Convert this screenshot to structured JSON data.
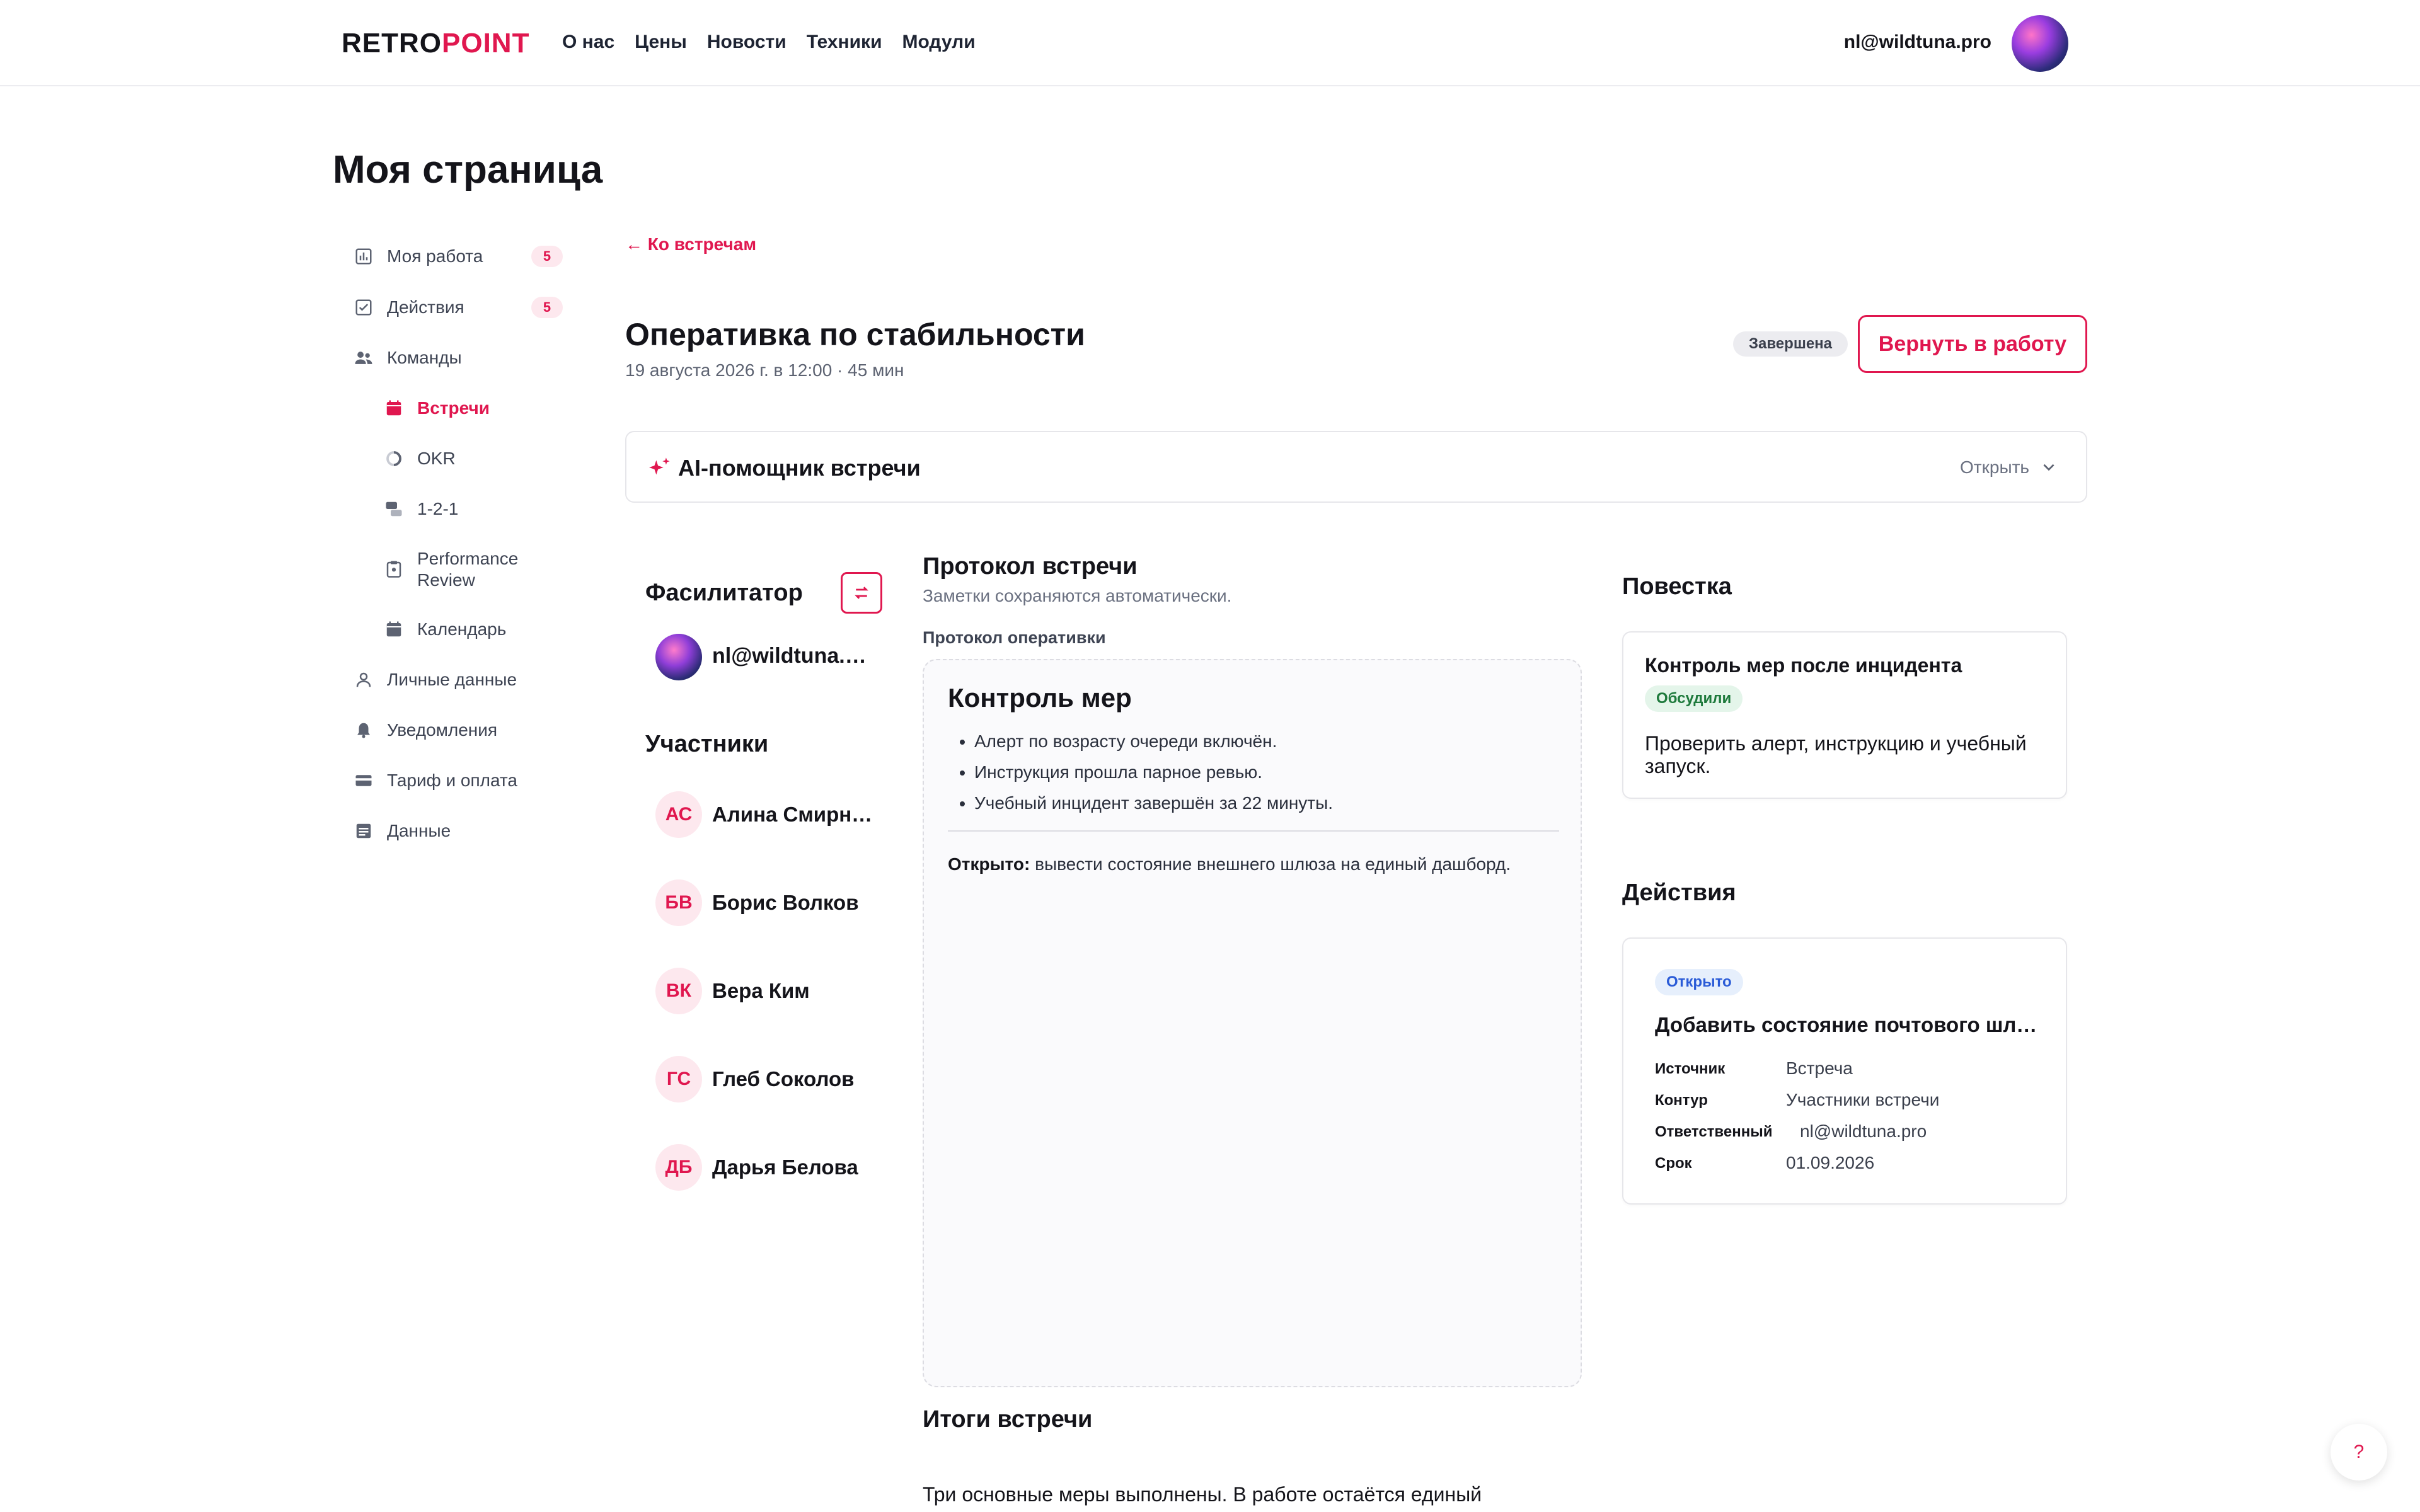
{
  "header": {
    "logo_part1": "RETRO",
    "logo_part2": "POINT",
    "nav": [
      "О нас",
      "Цены",
      "Новости",
      "Техники",
      "Модули"
    ],
    "user_email": "nl@wildtuna.pro"
  },
  "page_title": "Моя страница",
  "sidebar": {
    "items": [
      {
        "label": "Моя работа",
        "icon": "bar-chart-icon",
        "badge": "5"
      },
      {
        "label": "Действия",
        "icon": "checkbox-icon",
        "badge": "5"
      },
      {
        "label": "Команды",
        "icon": "people-icon"
      },
      {
        "label": "Встречи",
        "icon": "calendar-icon",
        "active": true
      },
      {
        "label": "OKR",
        "icon": "progress-ring-icon"
      },
      {
        "label": "1-2-1",
        "icon": "chat-bubbles-icon"
      },
      {
        "label": "Performance Review",
        "icon": "clipboard-icon"
      },
      {
        "label": "Календарь",
        "icon": "calendar-icon"
      },
      {
        "label": "Личные данные",
        "icon": "person-icon"
      },
      {
        "label": "Уведомления",
        "icon": "bell-icon"
      },
      {
        "label": "Тариф и оплата",
        "icon": "credit-card-icon"
      },
      {
        "label": "Данные",
        "icon": "database-icon"
      }
    ]
  },
  "meeting": {
    "back_link": "← Ко встречам",
    "title": "Оперативка по стабильности",
    "subtitle": "19 августа 2026 г. в 12:00 · 45 мин",
    "status": "Завершена",
    "return_button": "Вернуть в работу",
    "ai_title": "AI-помощник встречи",
    "ai_open": "Открыть"
  },
  "facilitator": {
    "heading": "Фасилитатор",
    "name": "nl@wildtuna.pro"
  },
  "participants": {
    "heading": "Участники",
    "list": [
      {
        "initials": "АС",
        "name": "Алина Смирнова"
      },
      {
        "initials": "БВ",
        "name": "Борис Волков"
      },
      {
        "initials": "ВК",
        "name": "Вера Ким"
      },
      {
        "initials": "ГС",
        "name": "Глеб Соколов"
      },
      {
        "initials": "ДБ",
        "name": "Дарья Белова"
      }
    ]
  },
  "protocol": {
    "heading": "Протокол встречи",
    "hint": "Заметки сохраняются автоматически.",
    "label": "Протокол оперативки",
    "doc_heading": "Контроль мер",
    "bullets": [
      "Алерт по возрасту очереди включён.",
      "Инструкция прошла парное ревью.",
      "Учебный инцидент завершён за 22 минуты."
    ],
    "open_label": "Открыто:",
    "open_text": " вывести состояние внешнего шлюза на единый дашборд."
  },
  "summary": {
    "heading": "Итоги встречи",
    "text": "Три основные меры выполнены. В работе остаётся единый"
  },
  "agenda": {
    "heading": "Повестка",
    "item_title": "Контроль мер после инцидента",
    "item_tag": "Обсудили",
    "item_desc": "Проверить алерт, инструкцию и учебный запуск."
  },
  "actions": {
    "heading": "Действия",
    "tag": "Открыто",
    "title": "Добавить состояние почтового шлюза на дашборд",
    "fields": [
      {
        "key": "Источник",
        "value": "Встреча"
      },
      {
        "key": "Контур",
        "value": "Участники встречи"
      },
      {
        "key": "Ответственный",
        "value": "nl@wildtuna.pro"
      },
      {
        "key": "Срок",
        "value": "01.09.2026"
      }
    ]
  },
  "help_label": "?",
  "colors": {
    "accent": "#e0174f",
    "text": "#14141a",
    "muted": "#6a7080"
  }
}
